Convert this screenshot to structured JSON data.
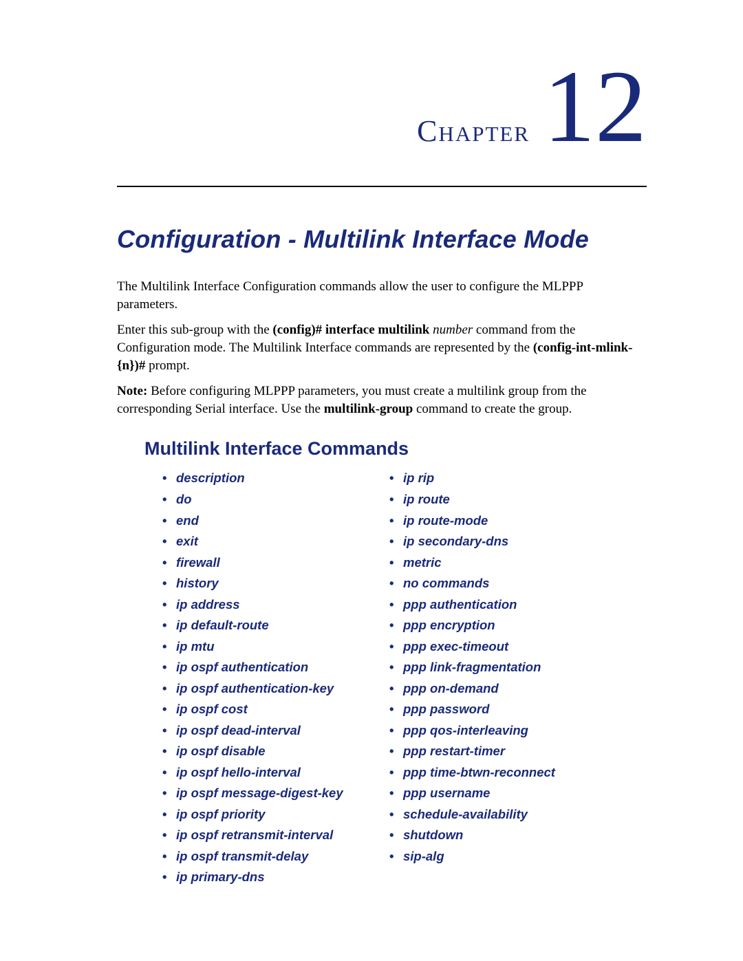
{
  "chapter": {
    "label": "Chapter",
    "number": "12"
  },
  "title": "Configuration - Multilink Interface Mode",
  "paragraphs": {
    "p1": "The Multilink Interface Configuration commands allow the user to configure the MLPPP parameters.",
    "p2_a": "Enter this sub-group with the ",
    "p2_cmd1": "(config)# interface multilink",
    "p2_arg": " number",
    "p2_b": " command from the Configuration mode.  The Multilink Interface commands are represented by the ",
    "p2_cmd2": "(config-int-mlink-{n})#",
    "p2_c": " prompt.",
    "p3_note": "Note:",
    "p3_a": "  Before configuring MLPPP parameters, you must create a multilink group from the corresponding Serial interface.  Use the ",
    "p3_cmd": "multilink-group",
    "p3_b": " command to create the group."
  },
  "section_heading": "Multilink Interface Commands",
  "commands": {
    "left": [
      "description",
      "do",
      "end",
      "exit",
      "firewall",
      "history",
      "ip address",
      "ip default-route",
      "ip mtu",
      "ip ospf authentication",
      "ip ospf authentication-key",
      "ip ospf cost",
      "ip ospf dead-interval",
      "ip ospf disable",
      "ip ospf hello-interval",
      "ip ospf message-digest-key",
      "ip ospf priority",
      "ip ospf retransmit-interval",
      "ip ospf transmit-delay",
      "ip primary-dns"
    ],
    "right": [
      "ip rip",
      "ip route",
      "ip route-mode",
      "ip secondary-dns",
      "metric",
      "no commands",
      "ppp authentication",
      "ppp encryption",
      "ppp exec-timeout",
      "ppp link-fragmentation",
      "ppp on-demand",
      "ppp password",
      "ppp qos-interleaving",
      "ppp restart-timer",
      "ppp time-btwn-reconnect",
      "ppp username",
      "schedule-availability",
      "shutdown",
      "sip-alg"
    ]
  }
}
